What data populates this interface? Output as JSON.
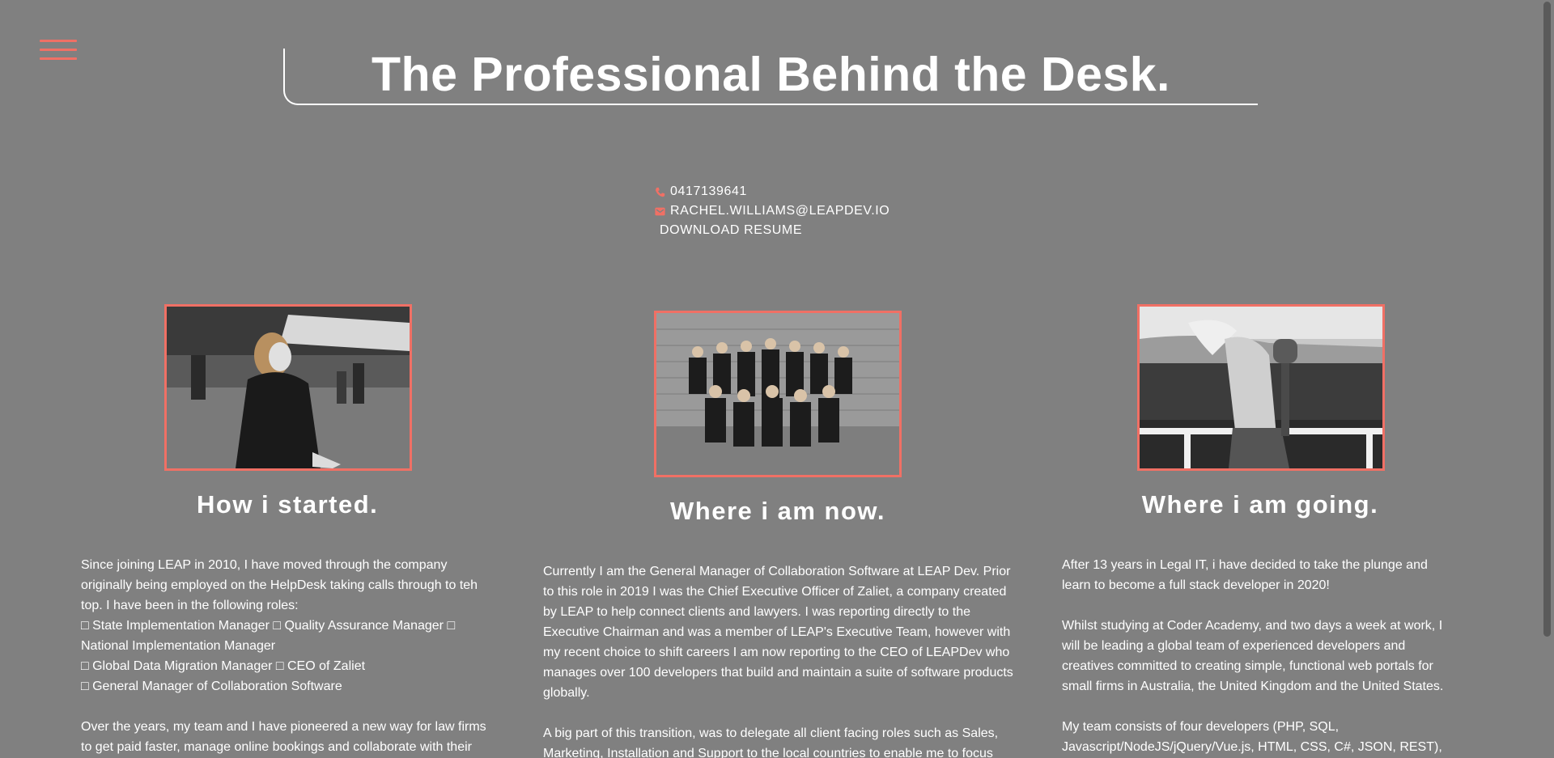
{
  "header": {
    "title": "The Professional Behind the Desk."
  },
  "contact": {
    "phone": "0417139641",
    "email": "RACHEL.WILLIAMS@LEAPDEV.IO",
    "download_label": "DOWNLOAD RESUME"
  },
  "columns": [
    {
      "heading": "How i started.",
      "paragraphs": [
        "Since joining LEAP in 2010, I have moved through the company originally being employed on the HelpDesk taking calls through to teh top. I have been in the following roles:",
        "□ State Implementation Manager □ Quality Assurance Manager □ National Implementation Manager",
        "□ Global Data Migration Manager □ CEO of Zaliet",
        "□ General Manager of Collaboration Software",
        "Over the years, my team and I have pioneered a new way for law firms to get paid faster, manage online bookings and collaborate with their"
      ]
    },
    {
      "heading": "Where i am now.",
      "paragraphs": [
        "Currently I am the General Manager of Collaboration Software at LEAP Dev. Prior to this role in 2019 I was the Chief Executive Officer of Zaliet, a company created by LEAP to help connect clients and lawyers. I was reporting directly to the Executive Chairman and was a member of LEAP's Executive Team, however with my recent choice to shift careers I am now reporting to the CEO of LEAPDev who manages over 100 developers that build and maintain a suite of software products globally.",
        "A big part of this transition, was to delegate all client facing roles such as Sales, Marketing, Installation and Support to the local countries to enable me to focus"
      ]
    },
    {
      "heading": "Where i am going.",
      "paragraphs": [
        "After 13 years in Legal IT, i have decided to take the plunge and learn to become a full stack developer in 2020!",
        "Whilst studying at Coder Academy, and two days a week at work, I will be leading a global team of experienced developers and creatives committed to creating simple, functional web portals for small firms in Australia, the United Kingdom and the United States.",
        "My team consists of four developers (PHP, SQL, Javascript/NodeJS/jQuery/Vue.js, HTML, CSS, C#, JSON, REST),"
      ]
    }
  ],
  "colors": {
    "background": "#808080",
    "accent": "#f07065",
    "text": "#ffffff"
  },
  "icons": {
    "menu": "hamburger-menu-icon",
    "phone": "phone-icon",
    "email": "envelope-icon"
  }
}
